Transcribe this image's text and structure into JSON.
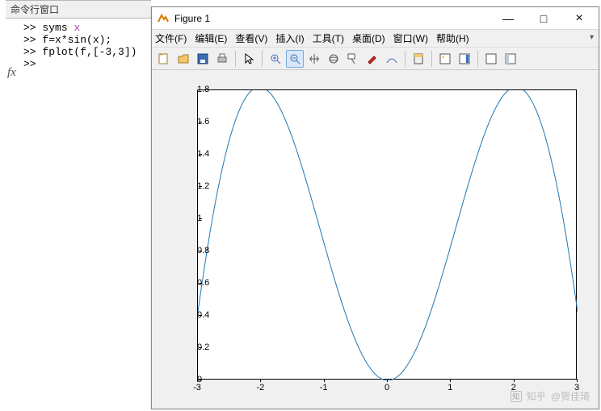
{
  "command_window": {
    "title": "命令行窗口",
    "lines": [
      {
        "prompt": ">>",
        "text_a": "syms ",
        "text_b": "x"
      },
      {
        "prompt": ">>",
        "text_a": "f=x*sin(x);",
        "text_b": ""
      },
      {
        "prompt": ">>",
        "text_a": "fplot(f,[-3,3])",
        "text_b": ""
      },
      {
        "prompt": ">>",
        "text_a": "",
        "text_b": ""
      }
    ],
    "fx_label": "fx"
  },
  "figure_window": {
    "title": "Figure 1",
    "minimize": "—",
    "maximize": "□",
    "close": "×",
    "menu": {
      "file": "文件(F)",
      "edit": "编辑(E)",
      "view": "查看(V)",
      "insert": "插入(I)",
      "tools": "工具(T)",
      "desktop": "桌面(D)",
      "window": "窗口(W)",
      "help": "帮助(H)"
    }
  },
  "chart_data": {
    "type": "line",
    "function": "x*sin(x)",
    "xlim": [
      -3,
      3
    ],
    "ylim": [
      0,
      1.8
    ],
    "xticks": [
      -3,
      -2,
      -1,
      0,
      1,
      2,
      3
    ],
    "yticks": [
      0,
      0.2,
      0.4,
      0.6,
      0.8,
      1,
      1.2,
      1.4,
      1.6,
      1.8
    ],
    "series": [
      {
        "name": "x*sin(x)",
        "color": "#1f77b4",
        "points": [
          [
            -3.0,
            0.4234
          ],
          [
            -2.8,
            1.092
          ],
          [
            -2.6,
            1.644
          ],
          [
            -2.4,
            1.8068
          ],
          [
            -2.2,
            1.7808
          ],
          [
            -2.0,
            1.8186
          ],
          [
            -1.8,
            1.7537
          ],
          [
            -1.6,
            1.5993
          ],
          [
            -1.4,
            1.3796
          ],
          [
            -1.2,
            1.1184
          ],
          [
            -1.0,
            0.8415
          ],
          [
            -0.8,
            0.5739
          ],
          [
            -0.6,
            0.3388
          ],
          [
            -0.4,
            0.1558
          ],
          [
            -0.2,
            0.0397
          ],
          [
            0.0,
            0.0
          ],
          [
            0.2,
            0.0397
          ],
          [
            0.4,
            0.1558
          ],
          [
            0.6,
            0.3388
          ],
          [
            0.8,
            0.5739
          ],
          [
            1.0,
            0.8415
          ],
          [
            1.2,
            1.1184
          ],
          [
            1.4,
            1.3796
          ],
          [
            1.6,
            1.5993
          ],
          [
            1.8,
            1.7537
          ],
          [
            2.0,
            1.8186
          ],
          [
            2.2,
            1.7808
          ],
          [
            2.4,
            1.8068
          ],
          [
            2.6,
            1.644
          ],
          [
            2.8,
            1.092
          ],
          [
            3.0,
            0.4234
          ]
        ]
      }
    ]
  },
  "watermark": {
    "brand": "知乎",
    "handle": "@贺佳琦"
  }
}
